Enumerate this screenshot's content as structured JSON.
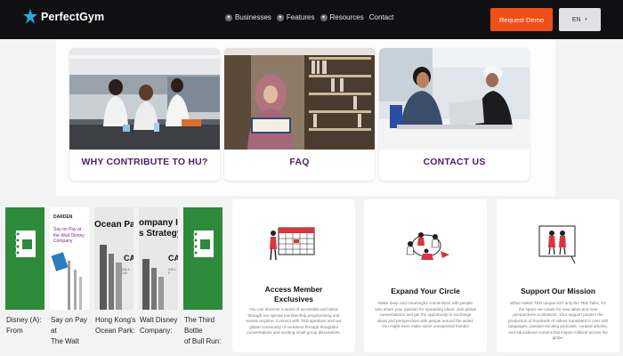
{
  "nav": {
    "brand": "PerfectGym",
    "menu": [
      {
        "label": "Businesses",
        "icon": "chevron-down-icon"
      },
      {
        "label": "Features",
        "icon": "chevron-down-icon"
      },
      {
        "label": "Resources",
        "icon": "chevron-down-icon"
      },
      {
        "label": "Contact",
        "icon": ""
      }
    ],
    "request_demo": "Request Demo",
    "language": "EN"
  },
  "top_cards": [
    {
      "label": "WHY CONTRIBUTE TO HU?",
      "photo": "students-in-lab-photo"
    },
    {
      "label": "FAQ",
      "photo": "student-reading-in-library-photo"
    },
    {
      "label": "CONTACT US",
      "photo": "students-with-laptop-photo"
    }
  ],
  "books": [
    {
      "title": "Disney (A):\nFrom",
      "cover_color": "#2e8b3a"
    },
    {
      "title": "Say on Pay at\nThe Walt",
      "cover_color": "#ffffff"
    },
    {
      "title": "Hong Kong's\nOcean Park:",
      "cover_color": "#e8e8e8"
    },
    {
      "title": "Walt Disney\nCompany:",
      "cover_color": "#e8e8e8"
    },
    {
      "title": "The Third Bottle\nof Bull Run: The",
      "cover_color": "#2e8b3a"
    }
  ],
  "book_cover_text": {
    "say_on_pay_publisher": "DARDEN",
    "say_on_pay_cover": "Say on Pay at the Walt Disney Company",
    "ocean_park_cover": "Ocean Park Tal",
    "ocean_park_tag": "CA",
    "ocean_park_code": "9-B-1-140",
    "walt_disney_cover": "ompany Inves\ns Strategy",
    "walt_disney_tag": "CA",
    "walt_disney_code": "9-B-1-0"
  },
  "features": [
    {
      "title": "Access Member\nExclusives",
      "description": "You can discover a world of accessible and ideas through our special membership programming and events anytime. Connect with TED speakers and our global community of members through thoughtful conversations and exciting small group discussions.",
      "icon": "calendar-icon"
    },
    {
      "title": "Expand Your Circle",
      "description": "Make deep and meaningful connections with people who share your passion for spreading ideas. Join global conversations and get the opportunity to exchange ideas and perspectives with people around the world. You might even make some unexpected friends!",
      "icon": "people-network-icon"
    },
    {
      "title": "Support Our Mission",
      "description": "What makes TED unique isn't only the TED Talks, it's the space we create for new ideas and new perspectives to blossom. Your support powers the production of hundreds of videos translated in over 100 languages, passion-exciting podcasts, curated articles, and educational content that inspire millions across the globe.",
      "icon": "presentation-icon"
    }
  ],
  "colors": {
    "nav_bg": "#101012",
    "accent": "#f04f17",
    "card_label": "#4b1d6b"
  }
}
